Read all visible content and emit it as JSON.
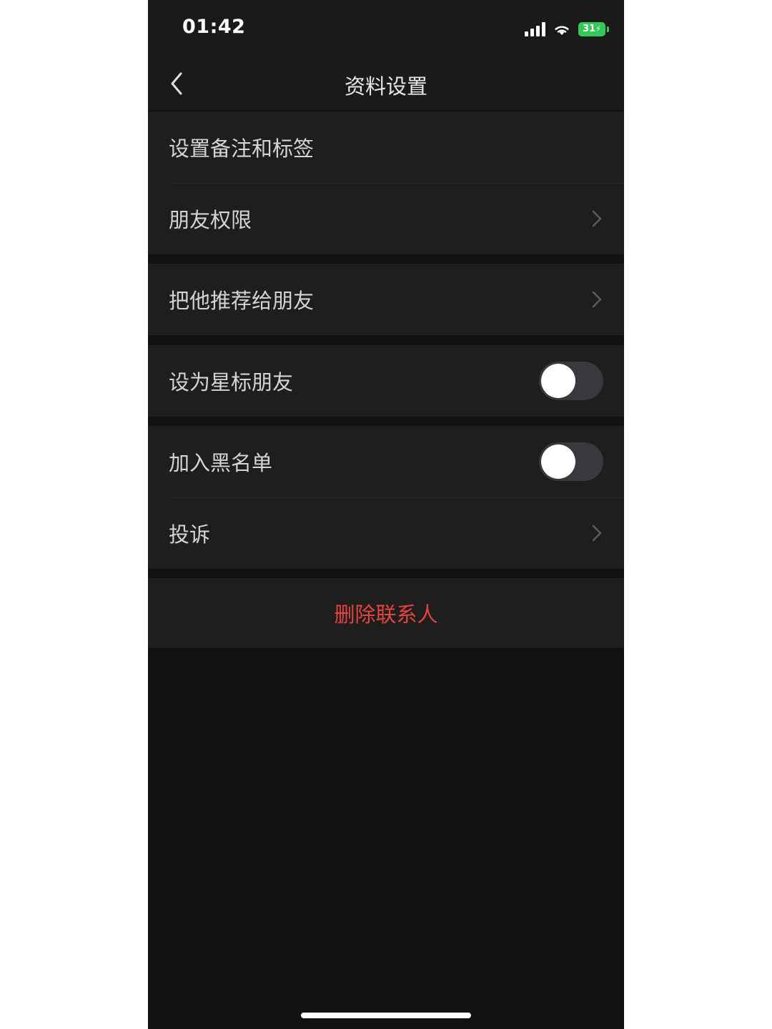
{
  "status_bar": {
    "time": "01:42",
    "battery": "31",
    "icons": [
      "signal-icon",
      "wifi-icon",
      "battery-icon"
    ]
  },
  "nav": {
    "title": "资料设置",
    "back_icon": "chevron-left-icon"
  },
  "groups": [
    {
      "items": [
        {
          "label": "设置备注和标签",
          "type": "plain"
        },
        {
          "label": "朋友权限",
          "type": "chevron"
        }
      ]
    },
    {
      "items": [
        {
          "label": "把他推荐给朋友",
          "type": "chevron"
        }
      ]
    },
    {
      "items": [
        {
          "label": "设为星标朋友",
          "type": "toggle",
          "on": false
        }
      ]
    },
    {
      "items": [
        {
          "label": "加入黑名单",
          "type": "toggle",
          "on": false
        },
        {
          "label": "投诉",
          "type": "chevron"
        }
      ]
    }
  ],
  "delete_contact": {
    "label": "删除联系人"
  },
  "colors": {
    "background": "#111111",
    "cell": "#1e1e1e",
    "text": "#d4d4d4",
    "danger": "#e64340",
    "battery": "#34c759"
  }
}
